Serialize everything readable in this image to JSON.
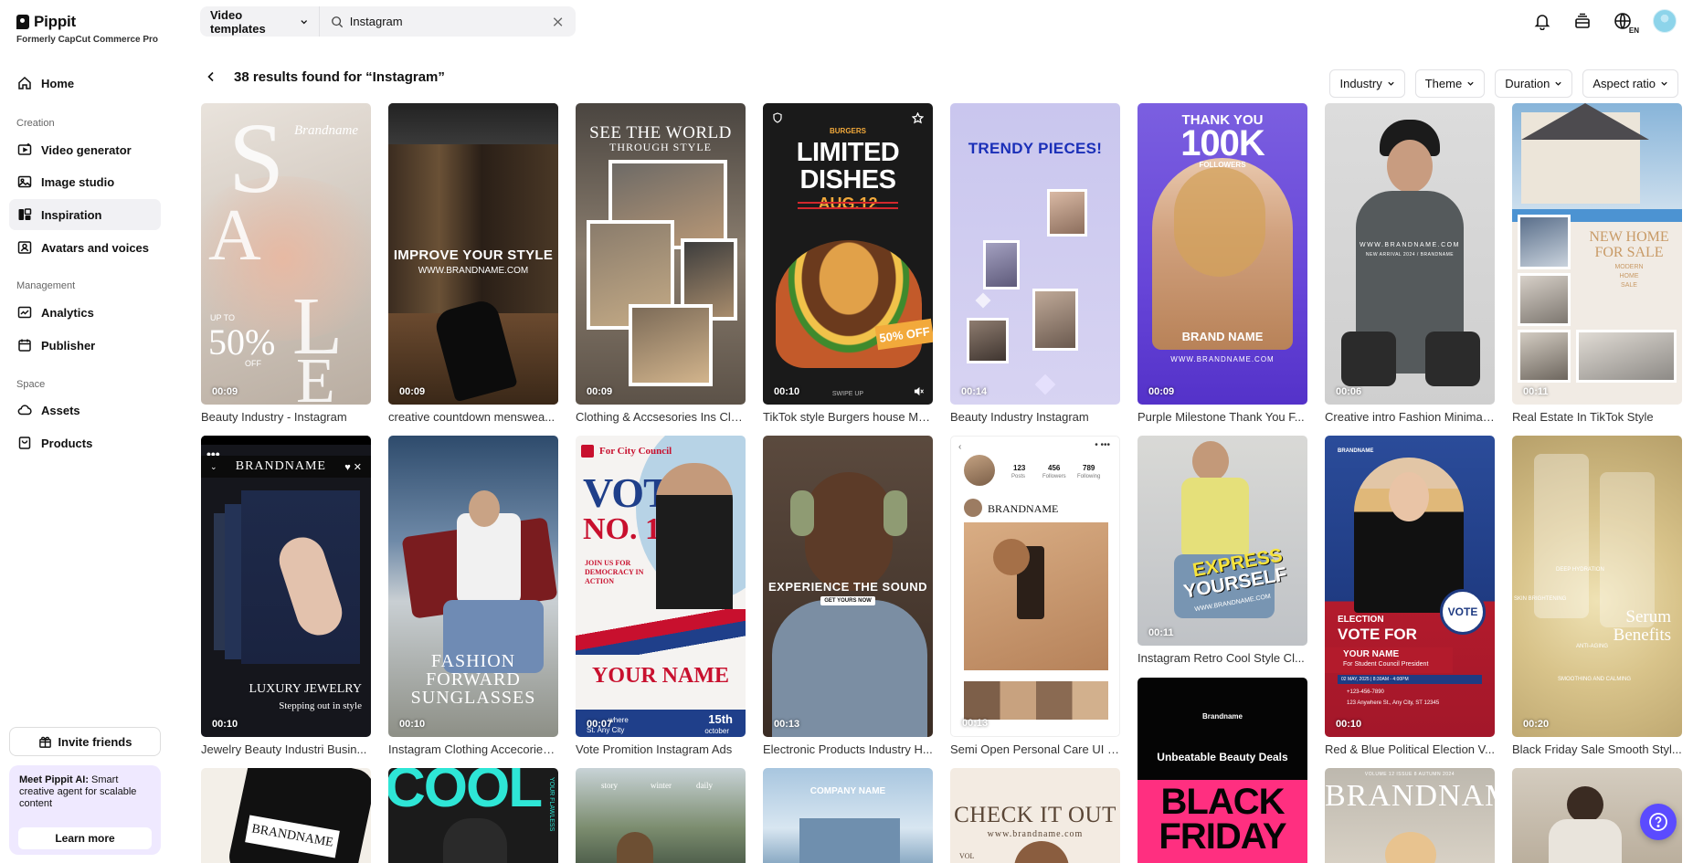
{
  "app": {
    "logo_text": "Pippit",
    "logo_sub": "Formerly CapCut Commerce Pro"
  },
  "sidebar": {
    "home": "Home",
    "section_creation": "Creation",
    "video_generator": "Video generator",
    "image_studio": "Image studio",
    "inspiration": "Inspiration",
    "avatars_voices": "Avatars and voices",
    "section_management": "Management",
    "analytics": "Analytics",
    "publisher": "Publisher",
    "section_space": "Space",
    "assets": "Assets",
    "products": "Products",
    "invite": "Invite friends",
    "promo_bold": "Meet Pippit AI:",
    "promo_text": " Smart creative agent for scalable content",
    "learn_more": "Learn more"
  },
  "search": {
    "type": "Video templates",
    "value": "Instagram"
  },
  "results": {
    "title": "38 results found for “Instagram”"
  },
  "filters": [
    "Industry",
    "Theme",
    "Duration",
    "Aspect ratio"
  ],
  "cards": {
    "c1": {
      "caption": "Beauty Industry - Instagram",
      "duration": "00:09",
      "t1": "Brandname",
      "t2": "UP TO",
      "t3": "50%",
      "t4": "OFF"
    },
    "c2": {
      "caption": "creative countdown menswea...",
      "duration": "00:09",
      "t1": "IMPROVE YOUR STYLE",
      "t2": "WWW.BRANDNAME.COM"
    },
    "c3": {
      "caption": "Clothing & Accsesories Ins Cla...",
      "duration": "00:09",
      "t1": "SEE THE WORLD",
      "t2": "THROUGH STYLE"
    },
    "c4": {
      "caption": "TikTok style Burgers house Me...",
      "duration": "00:10",
      "t0": "BURGERS",
      "t1": "LIMITED",
      "t2": "DISHES",
      "t3": "AUG.12",
      "t4": "50% OFF",
      "t5": "SWIPE UP"
    },
    "c5": {
      "caption": "Beauty Industry Instagram",
      "duration": "00:14",
      "t1": "TRENDY PIECES!"
    },
    "c6": {
      "caption": "Purple Milestone Thank You F...",
      "duration": "00:09",
      "t1": "THANK YOU",
      "t2": "100K",
      "t3": "FOLLOWERS",
      "t4": "BRAND NAME",
      "t5": "WWW.BRANDNAME.COM"
    },
    "c7": {
      "caption": "Creative intro Fashion Minimali...",
      "duration": "00:06",
      "t1": "WWW.BRANDNAME.COM",
      "t2": "NEW ARRIVAL 2024 / BRANDNAME"
    },
    "c8": {
      "caption": "Real Estate In TikTok Style",
      "duration": "00:11",
      "t1": "NEW HOME",
      "t2": "FOR SALE",
      "t3": "MODERN",
      "t4": "HOME",
      "t5": "SALE"
    },
    "c9": {
      "caption": "Jewelry Beauty Industri Busin...",
      "duration": "00:10",
      "t1": "BRANDNAME",
      "t2": "LUXURY JEWELRY",
      "t3": "Stepping out in style"
    },
    "c10": {
      "caption": "Instagram Clothing Accecories...",
      "duration": "00:10",
      "t1": "FASHION",
      "t2": "FORWARD",
      "t3": "SUNGLASSES"
    },
    "c11": {
      "caption": "Vote Promition Instagram Ads",
      "duration": "00:07",
      "t0": "For City Council",
      "t1": "VOTE",
      "t2": "NO. 1",
      "t3": "JOIN US FOR DEMOCRACY IN ACTION",
      "t4": "YOUR NAME",
      "t5": "15th",
      "t6": "october",
      "t7": "where",
      "t8": "St. Any City"
    },
    "c12": {
      "caption": "Electronic Products Industry H...",
      "duration": "00:13",
      "t1": "EXPERIENCE THE SOUND",
      "t2": "GET YOURS NOW"
    },
    "c13": {
      "caption": "Semi Open Personal Care UI I...",
      "duration": "00:13",
      "t1": "BRANDNAME",
      "s1": "123",
      "s2": "456",
      "s3": "789",
      "l1": "Posts",
      "l2": "Followers",
      "l3": "Following"
    },
    "c14": {
      "caption": "Instagram Retro Cool Style Cl...",
      "duration": "00:11",
      "t1": "EXPRESS",
      "t2": "YOURSELF",
      "t3": "WWW.BRANDNAME.COM"
    },
    "c15": {
      "caption": "Red & Blue Political Election V...",
      "duration": "00:10",
      "t0": "BRANDNAME",
      "t1": "ELECTION",
      "t2": "VOTE FOR",
      "t3": "YOUR NAME",
      "t4": "For Student Council President",
      "t5": "VOTE",
      "t6": "02 MAY, 2025  |  8:30AM - 4:00PM",
      "t7": "+123-456-7890",
      "t8": "123 Anywhere St., Any City, ST 12345"
    },
    "c16": {
      "caption": "Black Friday Sale Smooth Styl...",
      "duration": "00:20",
      "t1": "Serum",
      "t2": "Benefits",
      "t3": "DEEP HYDRATION",
      "t4": "SKIN BRIGHTENING",
      "t5": "ANTI-AGING",
      "t6": "SMOOTHING AND CALMING"
    },
    "c17": {
      "t1": "BRANDNAME"
    },
    "c18": {
      "t1": "COOL",
      "t2": "YOUR FLAWLESS"
    },
    "c19": {
      "t1": "story",
      "t2": "winter",
      "t3": "daily"
    },
    "c20": {
      "t1": "COMPANY NAME"
    },
    "c21": {
      "t1": "CHECK IT OUT",
      "t2": "www.brandname.com",
      "t3": "VOL"
    },
    "c22": {
      "t1": "Brandname",
      "t2": "Unbeatable Beauty Deals",
      "t3": "BLACK",
      "t4": "FRIDAY"
    },
    "c23": {
      "t1": "BRANDNAME",
      "t2": "VOLUME 12 ISSUE 8 AUTUMN 2024"
    },
    "c24": {
      "t1": ""
    }
  },
  "colors": {
    "accent": "#5b4bff",
    "promo_bg": "#efe9ff",
    "active_nav": "#f1f1f4"
  }
}
